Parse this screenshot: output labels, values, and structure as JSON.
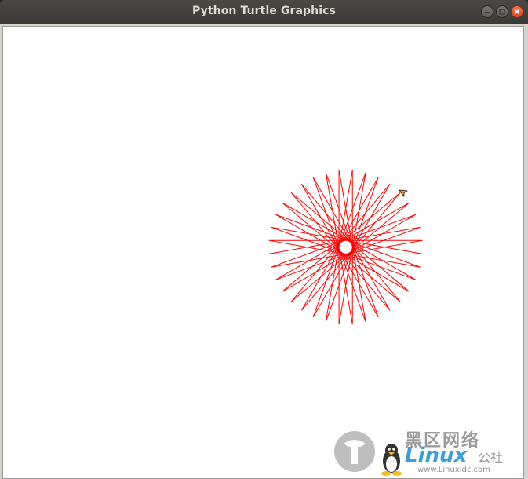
{
  "window": {
    "title": "Python Turtle Graphics",
    "buttons": {
      "minimize": "minimize-icon",
      "maximize": "maximize-icon",
      "close": "close-icon"
    }
  },
  "canvas": {
    "background": "#ffffff",
    "pen_color": "#ff0000",
    "turtle_color": "#ffa500",
    "star": {
      "points": 36,
      "turn_angle_deg": 170,
      "step": 200
    }
  },
  "watermark": {
    "line1": "黑区网络",
    "line2": "Linux",
    "line3": "公社",
    "url": "www.Linuxidc.com",
    "brand_color": "#1a8fd6"
  }
}
